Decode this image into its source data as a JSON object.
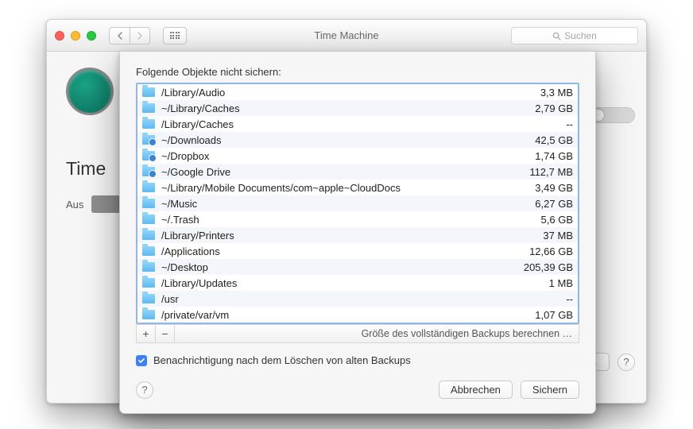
{
  "window": {
    "title": "Time Machine",
    "search_placeholder": "Suchen"
  },
  "bg": {
    "big_title": "Time",
    "aus_label": "Aus",
    "options_button_fragment": "en …"
  },
  "sheet": {
    "heading": "Folgende Objekte nicht sichern:",
    "calculate_label": "Größe des vollständigen Backups berechnen …",
    "notify_label": "Benachrichtigung nach dem Löschen von alten Backups",
    "cancel": "Abbrechen",
    "save": "Sichern",
    "add_label": "+",
    "remove_label": "−",
    "items": [
      {
        "path": "/Library/Audio",
        "size": "3,3 MB",
        "sync": false
      },
      {
        "path": "~/Library/Caches",
        "size": "2,79 GB",
        "sync": false
      },
      {
        "path": "/Library/Caches",
        "size": "--",
        "sync": false
      },
      {
        "path": "~/Downloads",
        "size": "42,5 GB",
        "sync": true
      },
      {
        "path": "~/Dropbox",
        "size": "1,74 GB",
        "sync": true
      },
      {
        "path": "~/Google Drive",
        "size": "112,7 MB",
        "sync": true
      },
      {
        "path": "~/Library/Mobile Documents/com~apple~CloudDocs",
        "size": "3,49 GB",
        "sync": false
      },
      {
        "path": "~/Music",
        "size": "6,27 GB",
        "sync": false
      },
      {
        "path": "~/.Trash",
        "size": "5,6 GB",
        "sync": false
      },
      {
        "path": "/Library/Printers",
        "size": "37 MB",
        "sync": false
      },
      {
        "path": "/Applications",
        "size": "12,66 GB",
        "sync": false
      },
      {
        "path": "~/Desktop",
        "size": "205,39 GB",
        "sync": false
      },
      {
        "path": "/Library/Updates",
        "size": "1 MB",
        "sync": false
      },
      {
        "path": "/usr",
        "size": "--",
        "sync": false
      },
      {
        "path": "/private/var/vm",
        "size": "1,07 GB",
        "sync": false
      }
    ]
  }
}
